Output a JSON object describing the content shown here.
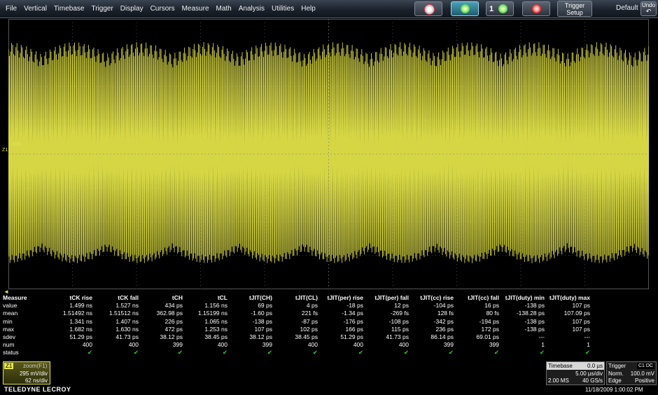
{
  "menu": [
    "File",
    "Vertical",
    "Timebase",
    "Trigger",
    "Display",
    "Cursors",
    "Measure",
    "Math",
    "Analysis",
    "Utilities",
    "Help"
  ],
  "toolbar": {
    "trigger_setup": [
      "Trigger",
      "Setup"
    ],
    "default_label": "Default",
    "undo_label": [
      "Undo",
      ""
    ],
    "btn3_label": "1"
  },
  "colors": {
    "trace": "#e8e84b",
    "check": "#2fd02f",
    "accent": "#4a9fb6"
  },
  "channel": {
    "label": "tCK",
    "marker": "Z1"
  },
  "measure": {
    "header": "Measure",
    "columns": [
      "tCK rise",
      "tCK fall",
      "tCH",
      "tCL",
      "tJIT(CH)",
      "tJIT(CL)",
      "tJIT(per) rise",
      "tJIT(per) fall",
      "tJIT(cc) rise",
      "tJIT(cc) fall",
      "tJIT(duty) min",
      "tJIT(duty) max"
    ],
    "rows": [
      {
        "label": "value",
        "cells": [
          "1.499 ns",
          "1.527 ns",
          "434 ps",
          "1.156 ns",
          "69 ps",
          "4 ps",
          "-18 ps",
          "12 ps",
          "-104 ps",
          "16 ps",
          "-138 ps",
          "107 ps"
        ]
      },
      {
        "label": "mean",
        "cells": [
          "1.51492 ns",
          "1.51512 ns",
          "362.98 ps",
          "1.15199 ns",
          "-1.60 ps",
          "221 fs",
          "-1.34 ps",
          "-269 fs",
          "128 fs",
          "80 fs",
          "-138.28 ps",
          "107.09 ps"
        ]
      },
      {
        "label": "min",
        "cells": [
          "1.341 ns",
          "1.407 ns",
          "226 ps",
          "1.065 ns",
          "-138 ps",
          "-87 ps",
          "-176 ps",
          "-108 ps",
          "-342 ps",
          "-194 ps",
          "-138 ps",
          "107 ps"
        ]
      },
      {
        "label": "max",
        "cells": [
          "1.682 ns",
          "1.630 ns",
          "472 ps",
          "1.253 ns",
          "107 ps",
          "102 ps",
          "166 ps",
          "115 ps",
          "236 ps",
          "172 ps",
          "-138 ps",
          "107 ps"
        ]
      },
      {
        "label": "sdev",
        "cells": [
          "51.29 ps",
          "41.73 ps",
          "38.12 ps",
          "38.45 ps",
          "38.12 ps",
          "38.45 ps",
          "51.29 ps",
          "41.73 ps",
          "86.14 ps",
          "69.01 ps",
          "---",
          "---"
        ]
      },
      {
        "label": "num",
        "cells": [
          "400",
          "400",
          "399",
          "400",
          "399",
          "400",
          "400",
          "400",
          "399",
          "399",
          "1",
          "1"
        ]
      },
      {
        "label": "status",
        "cells": [
          "✔",
          "✔",
          "✔",
          "✔",
          "✔",
          "✔",
          "✔",
          "✔",
          "✔",
          "✔",
          "✔",
          "✔"
        ]
      }
    ]
  },
  "zoom": {
    "tag": "Z1",
    "title": "zoom(F1)",
    "vdiv": "295 mV/div",
    "tdiv": "62 ns/div"
  },
  "brand": "TELEDYNE LECROY",
  "timebase": {
    "title": "Timebase",
    "delay": "0.0 µs",
    "tdiv": "5.00 µs/div",
    "samples": "2.00 MS",
    "rate": "40 GS/s"
  },
  "trigger": {
    "title": "Trigger",
    "badge": "C1 DC",
    "mode": "Norm.",
    "level": "100.0 mV",
    "type": "Edge",
    "slope": "Positive"
  },
  "timestamp": "11/18/2009 1:00:02 PM"
}
